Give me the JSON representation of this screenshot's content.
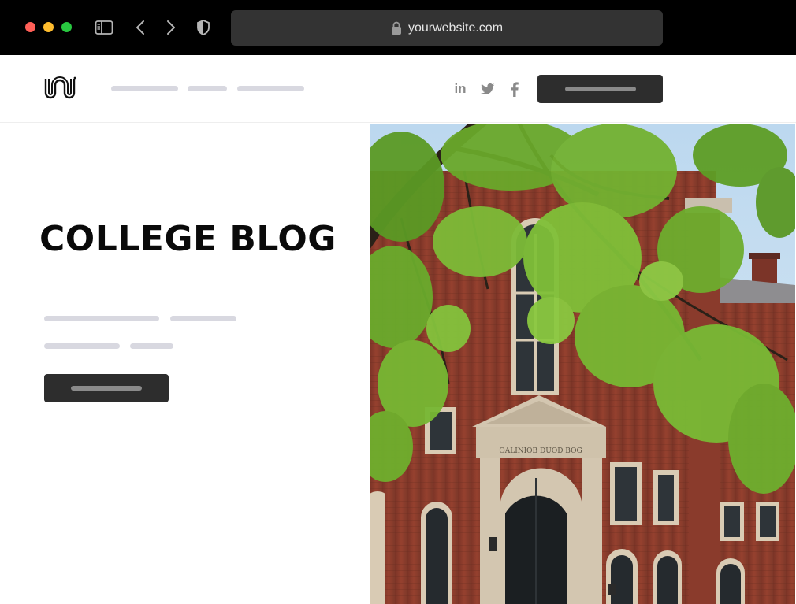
{
  "browser": {
    "url": "yourwebsite.com",
    "icons": [
      "sidebar-icon",
      "back-arrow-icon",
      "forward-arrow-icon",
      "shield-icon",
      "lock-icon"
    ]
  },
  "header": {
    "logo_icon": "logo-mark",
    "social_icons": [
      "linkedin-icon",
      "twitter-icon",
      "facebook-icon"
    ],
    "linkedin_glyph": "in"
  },
  "hero": {
    "title": "COLLEGE BLOG"
  },
  "photo": {
    "description_icon": "college-building-photo",
    "entrance_inscription": "OALINIOB DUOD BOG"
  },
  "colors": {
    "chrome_bg": "#000000",
    "address_bar": "#333333",
    "button_dark": "#2d2d2d",
    "placeholder_gray": "#d8d8e0",
    "brick": "#8a3b2c",
    "foliage": "#6fae2c"
  }
}
